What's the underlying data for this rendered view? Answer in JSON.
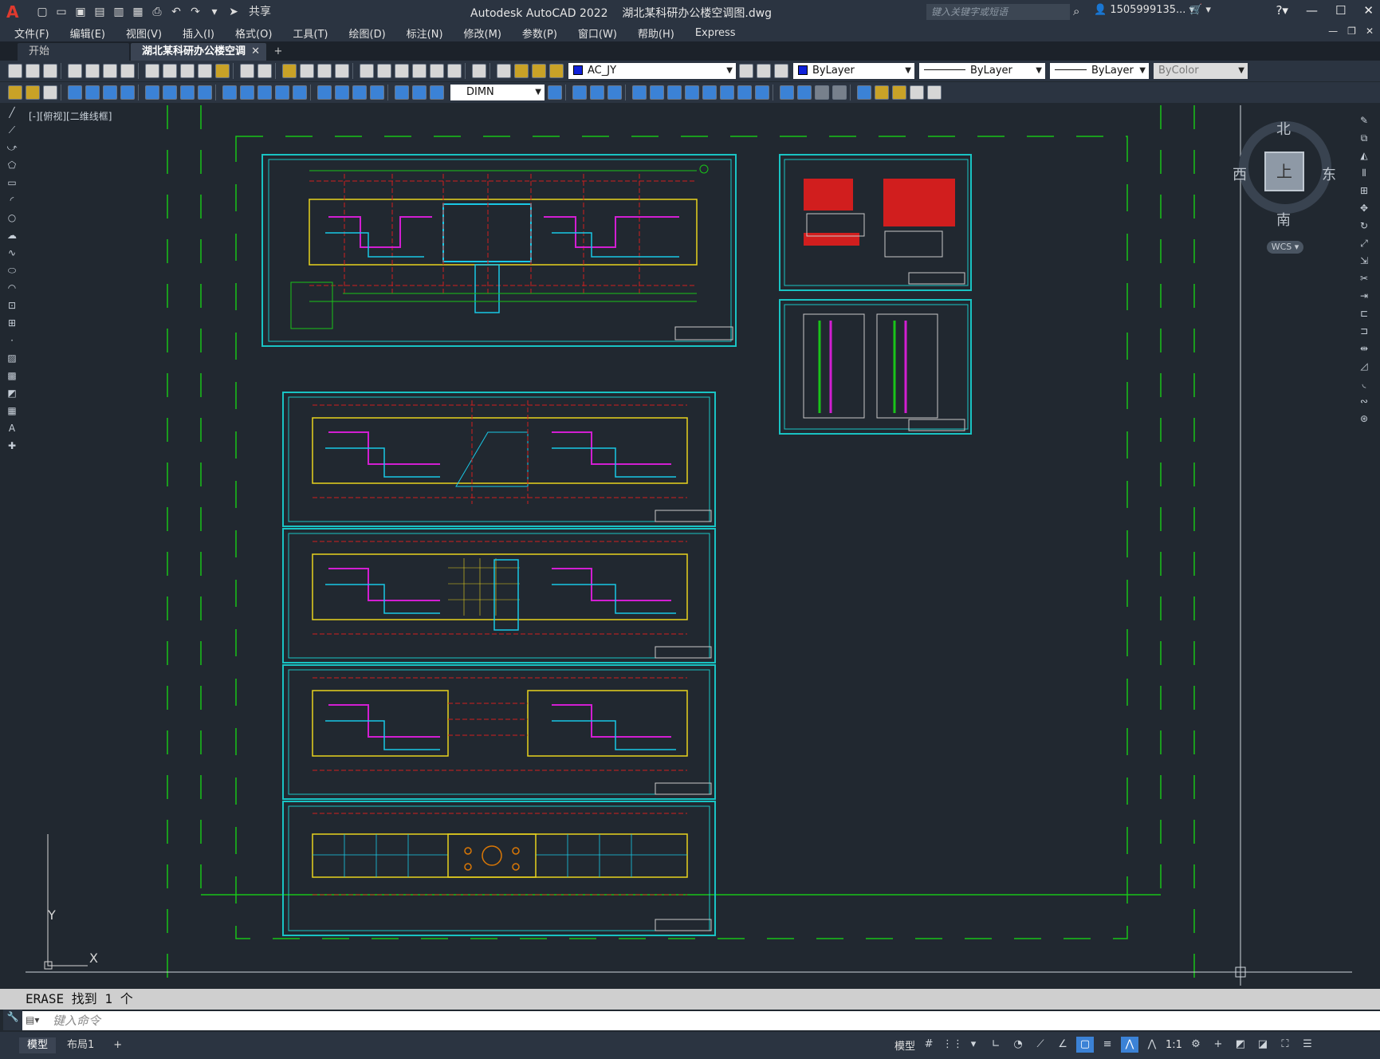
{
  "app": {
    "name": "Autodesk AutoCAD 2022",
    "file": "湖北某科研办公楼空调图.dwg",
    "search_placeholder": "键入关键字或短语",
    "user": "1505999135...",
    "share": "共享"
  },
  "menu": [
    "文件(F)",
    "编辑(E)",
    "视图(V)",
    "插入(I)",
    "格式(O)",
    "工具(T)",
    "绘图(D)",
    "标注(N)",
    "修改(M)",
    "参数(P)",
    "窗口(W)",
    "帮助(H)",
    "Express"
  ],
  "tabs": {
    "start": "开始",
    "active": "湖北某科研办公楼空调图*",
    "close": "✕",
    "add": "+"
  },
  "toolbar": {
    "layer": "AC_JY",
    "color": "ByLayer",
    "linetype": "ByLayer",
    "lineweight": "ByLayer",
    "plotstyle": "ByColor",
    "dimstyle": "DIMN"
  },
  "viewport": {
    "label": "[-][俯视][二维线框]",
    "compass": {
      "north": "北",
      "south": "南",
      "east": "东",
      "west": "西",
      "cube": "上"
    },
    "wcs": "WCS",
    "ucs_x": "X",
    "ucs_y": "Y"
  },
  "command": {
    "history": "ERASE 找到 1 个",
    "placeholder": "键入命令"
  },
  "status": {
    "model_tab": "模型",
    "layout_tab": "布局1",
    "add": "+",
    "model_btn": "模型",
    "scale": "1:1"
  },
  "colors": {
    "background": "#212830",
    "boundary_green": "#19c319",
    "frame_cyan": "#19c3c3",
    "wall_yellow": "#e8d21d",
    "axis_red": "#d11e1e",
    "duct_magenta": "#d21ed2",
    "pipe_cyan": "#19c8e6"
  }
}
